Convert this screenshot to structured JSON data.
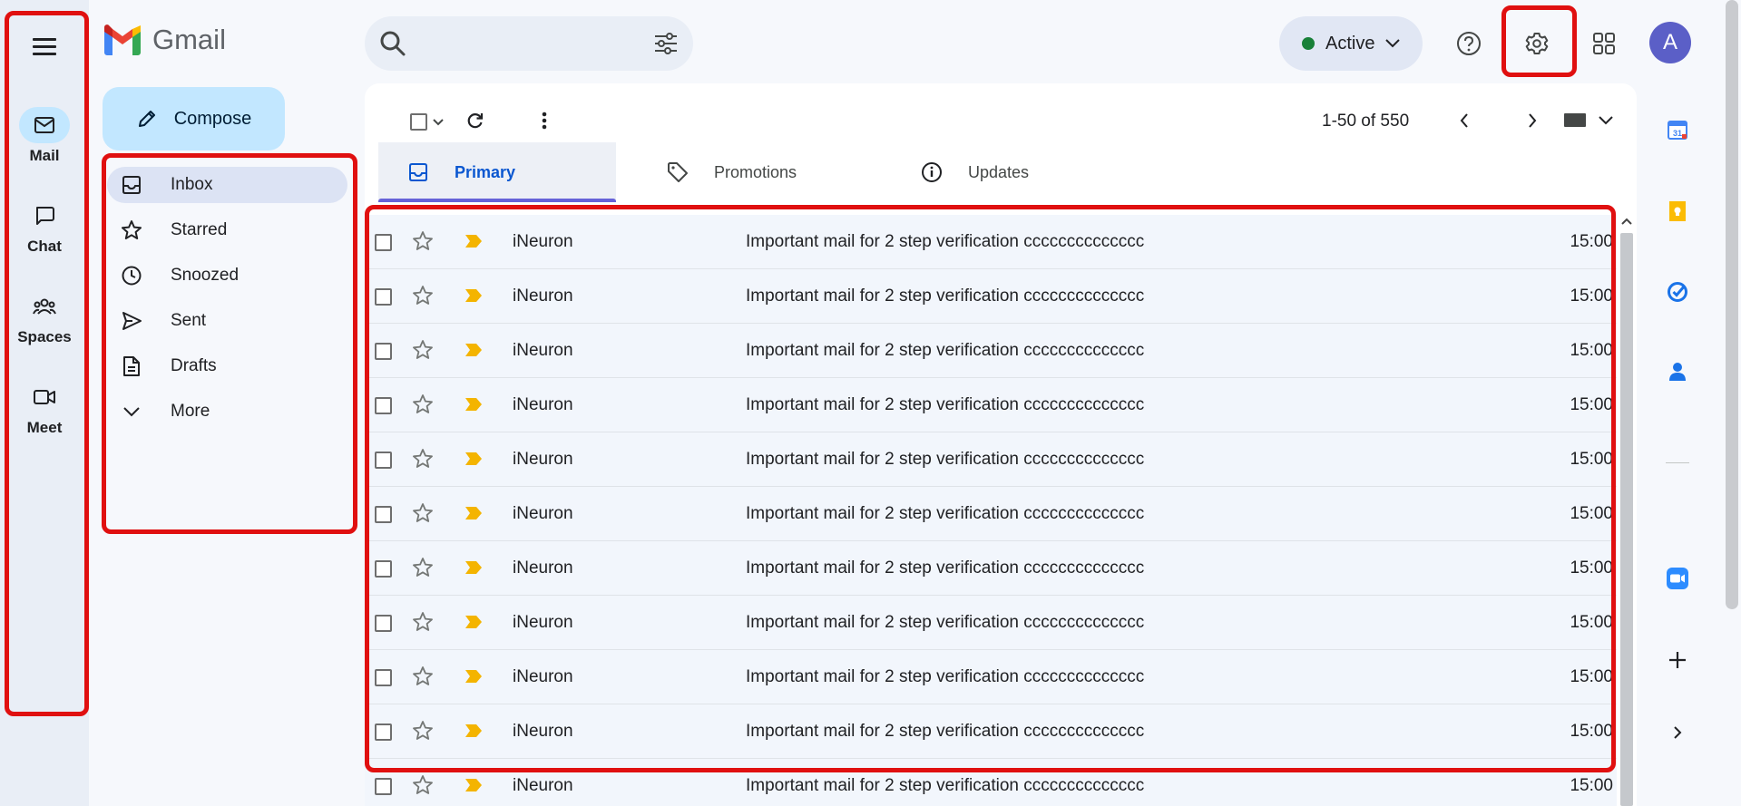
{
  "app": {
    "name": "Gmail"
  },
  "rail": {
    "items": [
      {
        "label": "Mail"
      },
      {
        "label": "Chat"
      },
      {
        "label": "Spaces"
      },
      {
        "label": "Meet"
      }
    ]
  },
  "compose": {
    "label": "Compose"
  },
  "nav": {
    "items": [
      {
        "label": "Inbox",
        "icon": "inbox-icon"
      },
      {
        "label": "Starred",
        "icon": "star-icon"
      },
      {
        "label": "Snoozed",
        "icon": "clock-icon"
      },
      {
        "label": "Sent",
        "icon": "send-icon"
      },
      {
        "label": "Drafts",
        "icon": "draft-icon"
      },
      {
        "label": "More",
        "icon": "chevron-down-icon"
      }
    ]
  },
  "search": {
    "placeholder": "",
    "value": ""
  },
  "status": {
    "label": "Active",
    "color": "#188038"
  },
  "account": {
    "initial": "A",
    "color": "#5b5fc7"
  },
  "toolbar": {
    "pager": "1-50 of 550"
  },
  "tabs": [
    {
      "label": "Primary"
    },
    {
      "label": "Promotions"
    },
    {
      "label": "Updates"
    }
  ],
  "emails": [
    {
      "sender": "iNeuron",
      "subject": "Important mail for 2 step verification cccccccccccccc",
      "time": "15:00"
    },
    {
      "sender": "iNeuron",
      "subject": "Important mail for 2 step verification cccccccccccccc",
      "time": "15:00"
    },
    {
      "sender": "iNeuron",
      "subject": "Important mail for 2 step verification cccccccccccccc",
      "time": "15:00"
    },
    {
      "sender": "iNeuron",
      "subject": "Important mail for 2 step verification cccccccccccccc",
      "time": "15:00"
    },
    {
      "sender": "iNeuron",
      "subject": "Important mail for 2 step verification cccccccccccccc",
      "time": "15:00"
    },
    {
      "sender": "iNeuron",
      "subject": "Important mail for 2 step verification cccccccccccccc",
      "time": "15:00"
    },
    {
      "sender": "iNeuron",
      "subject": "Important mail for 2 step verification cccccccccccccc",
      "time": "15:00"
    },
    {
      "sender": "iNeuron",
      "subject": "Important mail for 2 step verification cccccccccccccc",
      "time": "15:00"
    },
    {
      "sender": "iNeuron",
      "subject": "Important mail for 2 step verification cccccccccccccc",
      "time": "15:00"
    },
    {
      "sender": "iNeuron",
      "subject": "Important mail for 2 step verification cccccccccccccc",
      "time": "15:00"
    },
    {
      "sender": "iNeuron",
      "subject": "Important mail for 2 step verification cccccccccccccc",
      "time": "15:00"
    }
  ],
  "colors": {
    "highlight": "#e01010",
    "compose": "#c2e7ff",
    "accent": "#0b57d0",
    "important": "#f4b400"
  },
  "sidepanel": {
    "icons": [
      "calendar-icon",
      "keep-icon",
      "tasks-icon",
      "contacts-icon",
      "zoom-icon",
      "add-icon",
      "expand-icon"
    ]
  }
}
